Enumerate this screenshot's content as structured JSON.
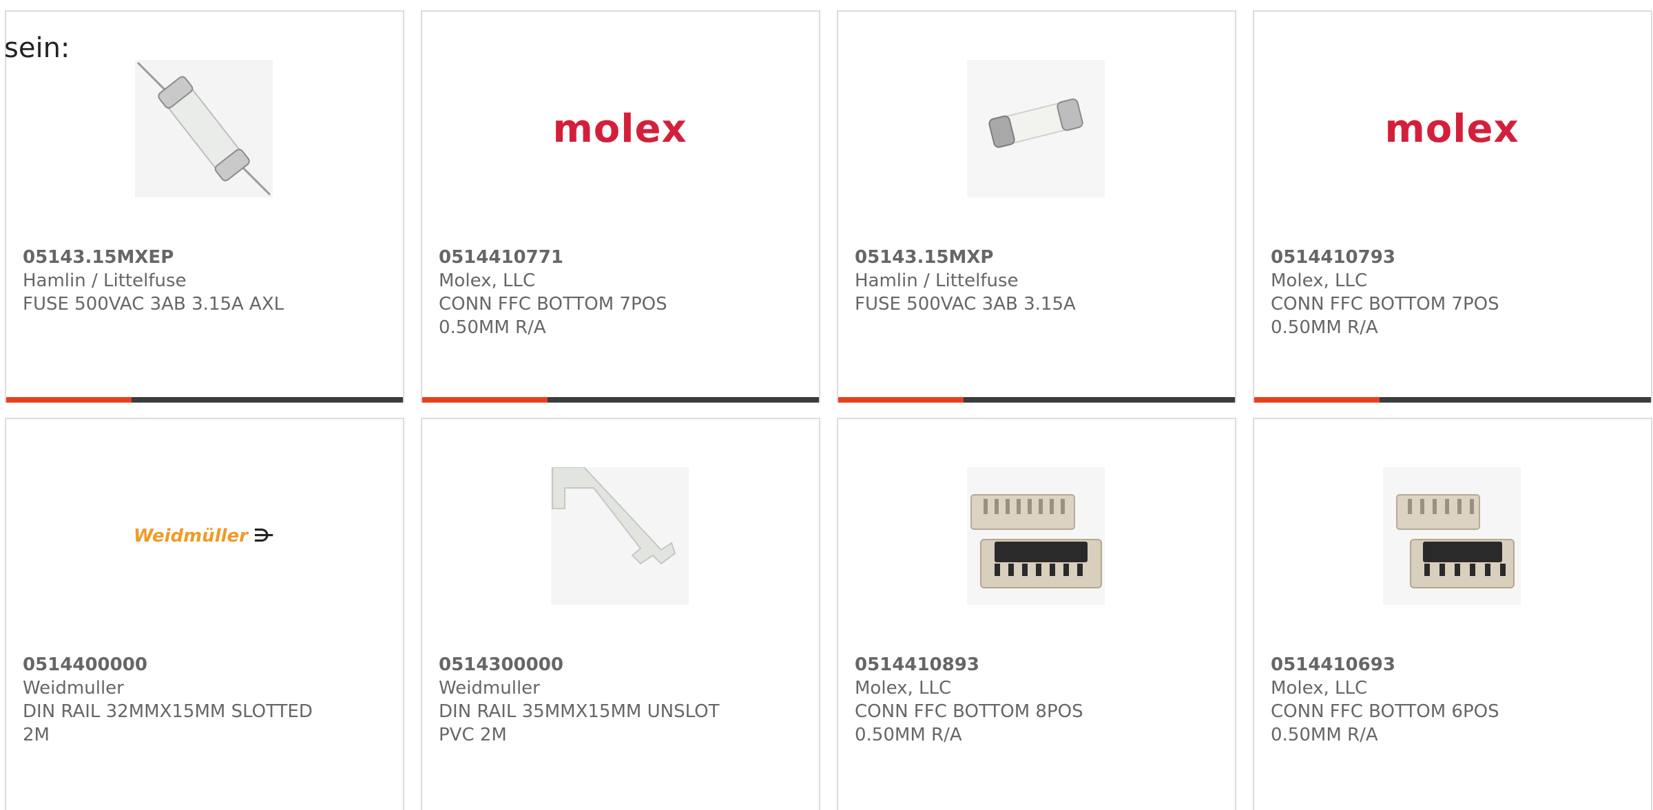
{
  "intro_text": "sein:",
  "colors": {
    "accent": "#e8401c",
    "bar_dark": "#3c3c3c",
    "card_border": "#dcdcdc",
    "text": "#666666",
    "molex_red": "#d41f3a",
    "weidmuller_orange": "#f19a28"
  },
  "products": [
    {
      "part_number": "05143.15MXEP",
      "manufacturer": "Hamlin / Littelfuse",
      "description": "FUSE 500VAC 3AB 3.15A AXL",
      "image": "axial-fuse-image"
    },
    {
      "part_number": "0514410771",
      "manufacturer": "Molex, LLC",
      "description": "CONN FFC BOTTOM 7POS 0.50MM R/A",
      "image": "molex-logo",
      "logo_text": "molex"
    },
    {
      "part_number": "05143.15MXP",
      "manufacturer": "Hamlin / Littelfuse",
      "description": "FUSE 500VAC 3AB 3.15A",
      "image": "cartridge-fuse-image"
    },
    {
      "part_number": "0514410793",
      "manufacturer": "Molex, LLC",
      "description": "CONN FFC BOTTOM 7POS 0.50MM R/A",
      "image": "molex-logo",
      "logo_text": "molex"
    },
    {
      "part_number": "0514400000",
      "manufacturer": "Weidmuller",
      "description": "DIN RAIL 32MMX15MM SLOTTED 2M",
      "image": "weidmuller-logo",
      "logo_text": "Weidmüller"
    },
    {
      "part_number": "0514300000",
      "manufacturer": "Weidmuller",
      "description": "DIN RAIL 35MMX15MM UNSLOT PVC 2M",
      "image": "din-rail-image"
    },
    {
      "part_number": "0514410893",
      "manufacturer": "Molex, LLC",
      "description": "CONN FFC BOTTOM 8POS 0.50MM R/A",
      "image": "ffc-connector-image"
    },
    {
      "part_number": "0514410693",
      "manufacturer": "Molex, LLC",
      "description": "CONN FFC BOTTOM 6POS 0.50MM R/A",
      "image": "ffc-connector-image"
    }
  ]
}
